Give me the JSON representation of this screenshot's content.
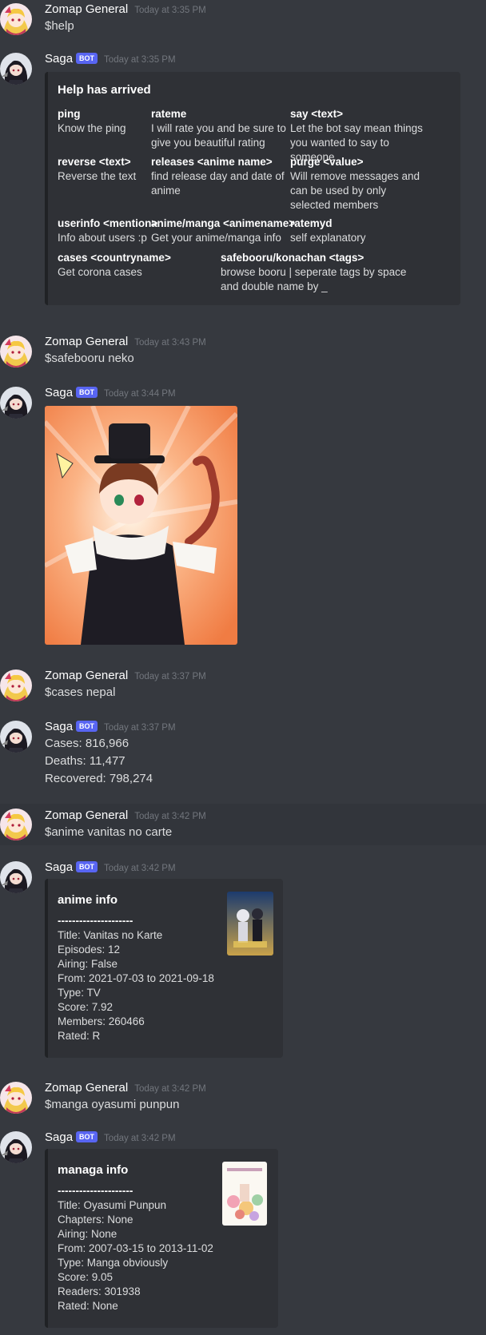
{
  "messages": [
    {
      "user": "Zomap General",
      "time": "Today at 3:35 PM",
      "text": "$help"
    },
    {
      "user": "Saga",
      "bot": "BOT",
      "time": "Today at 3:35 PM"
    },
    {
      "user": "Zomap General",
      "time": "Today at 3:43 PM",
      "text": "$safebooru neko"
    },
    {
      "user": "Saga",
      "bot": "BOT",
      "time": "Today at 3:44 PM"
    },
    {
      "user": "Zomap General",
      "time": "Today at 3:37 PM",
      "text": "$cases nepal"
    },
    {
      "user": "Saga",
      "bot": "BOT",
      "time": "Today at 3:37 PM",
      "lines": [
        "Cases: 816,966",
        "Deaths: 11,477",
        "Recovered: 798,274"
      ]
    },
    {
      "user": "Zomap General",
      "time": "Today at 3:42 PM",
      "text": "$anime vanitas no carte"
    },
    {
      "user": "Saga",
      "bot": "BOT",
      "time": "Today at 3:42 PM"
    },
    {
      "user": "Zomap General",
      "time": "Today at 3:42 PM",
      "text": "$manga oyasumi punpun"
    },
    {
      "user": "Saga",
      "bot": "BOT",
      "time": "Today at 3:42 PM"
    }
  ],
  "help_embed": {
    "title": "Help has arrived",
    "fields": [
      {
        "name": "ping",
        "value": "Know the ping"
      },
      {
        "name": "rateme",
        "value": "I will rate you and be sure to give you beautiful rating"
      },
      {
        "name": "say <text>",
        "value": "Let the bot say mean things you wanted to say to someone"
      },
      {
        "name": "reverse <text>",
        "value": "Reverse the text"
      },
      {
        "name": "releases <anime name>",
        "value": "find release day and date of anime"
      },
      {
        "name": "purge <value>",
        "value": "Will remove messages and can be used by only selected members"
      },
      {
        "name": "userinfo <mention>",
        "value": "Info about users :p"
      },
      {
        "name": "anime/manga <animename>",
        "value": "Get your anime/manga info"
      },
      {
        "name": "ratemyd",
        "value": "self explanatory"
      },
      {
        "name": "cases <countryname>",
        "value": "Get corona cases"
      },
      {
        "name": "safebooru/konachan <tags>",
        "value": "browse booru | seperate tags by space and double name by _"
      }
    ]
  },
  "anime_embed": {
    "title": "anime info",
    "separator": "---------------------",
    "lines": [
      "Title: Vanitas no Karte",
      "Episodes: 12",
      "Airing: False",
      "From: 2021-07-03 to 2021-09-18",
      "Type: TV",
      "Score: 7.92",
      "Members: 260466",
      "Rated: R"
    ]
  },
  "manga_embed": {
    "title": "managa info",
    "separator": "---------------------",
    "lines": [
      "Title: Oyasumi Punpun",
      "Chapters: None",
      "Airing: None",
      "From: 2007-03-15 to 2013-11-02",
      "Type: Manga obviously",
      "Score: 9.05",
      "Readers: 301938",
      "Rated: None"
    ]
  },
  "colors": {
    "background": "#36393f",
    "embed_bg": "#2f3136",
    "bot_tag": "#5865f2",
    "timestamp": "#72767d"
  }
}
